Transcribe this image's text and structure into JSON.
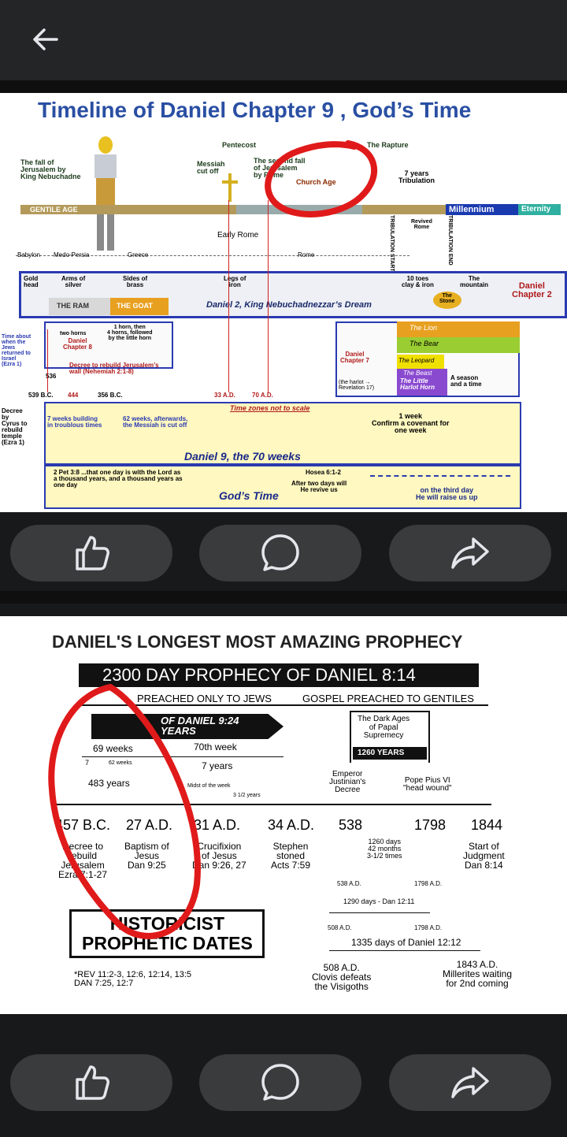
{
  "post1": {
    "title": "Timeline of Daniel Chapter 9 , God’s Time",
    "labels": {
      "fall_jerusalem": "The fall of\nJerusalem by\nKing Nebuchadne",
      "pentecost": "Pentecost",
      "rapture": "The Rapture",
      "messiah_cut": "Messiah\ncut off",
      "second_fall": "The second fall\nof Jerusalem\nby Rome",
      "church_age": "Church Age",
      "seven_years": "7 years\nTribulation",
      "gentile_age": "GENTILE AGE",
      "millennium": "Millennium",
      "eternity": "Eternity",
      "revived_rome": "Revived\nRome",
      "early_rome": "Early Rome",
      "trib_start": "TRIBULATION START",
      "trib_end": "TRIBULATION END",
      "babylon": "Babylon",
      "medo_persia": "Medo-Persia",
      "greece": "Greece",
      "rome": "Rome",
      "gold_head": "Gold\nhead",
      "arms_silver": "Arms of\nsilver",
      "sides_brass": "Sides of\nbrass",
      "legs_iron": "Legs of\niron",
      "toes": "10 toes\nclay & iron",
      "the_mountain": "The\nmountain",
      "daniel_ch2": "Daniel\nChapter 2",
      "the_ram": "THE RAM",
      "the_goat": "THE GOAT",
      "dream": "Daniel 2, King Nebuchadnezzar’s Dream",
      "the_stone": "The\nStone",
      "time_about": "Time about\nwhen the\nJews\nreturned to\nIsrael\n(Ezra 1)",
      "two_horns": "two horns",
      "daniel_ch8": "Daniel\nChapter 8",
      "one_horn": "1 horn, then\n4 horns, followed\nby the little horn",
      "the_lion": "The Lion",
      "the_bear": "The Bear",
      "the_leopard": "The Leopard",
      "the_beast": "The Beast",
      "the_little_horn": "The Little\nHarlot Horn",
      "daniel_ch7": "Daniel\nChapter 7",
      "season": "A season\nand a time",
      "harlot": "(the harlot →\nRevelation 17)",
      "decree_wall": "Decree to rebuild Jerusalem’s\nwall (Nehemiah 2:1-8)",
      "y536": "536",
      "y539": "539 B.C.",
      "y444": "444",
      "y356": "356 B.C.",
      "y33": "33 A.D.",
      "y70": "70 A.D.",
      "time_zones": "Time zones not to scale",
      "decree_cyrus": "Decree\nby\nCyrus to\nrebuild\ntemple\n(Ezra 1)",
      "seven_weeks": "7 weeks building\nin troublous times",
      "sixty_two": "62 weeks, afterwards,\nthe Messiah is cut off",
      "one_week": "1 week\nConfirm a covenant for\none week",
      "seventy_weeks": "Daniel 9, the 70 weeks",
      "pet": "2 Pet 3:8 ...that one day is with the Lord as\na thousand years, and a thousand years as\none day",
      "hosea": "Hosea 6:1-2",
      "after_two": "After two days will\nHe revive us",
      "gods_time": "God’s Time",
      "third_day": "on the third day\nHe will raise us up"
    }
  },
  "post2": {
    "title": "DANIEL'S LONGEST MOST AMAZING PROPHECY",
    "banner": "2300 DAY PROPHECY OF DANIEL 8:14",
    "preached_jews": "PREACHED ONLY TO JEWS",
    "gospel_gentiles": "GOSPEL PREACHED TO GENTILES",
    "of_daniel": "OF DANIEL 9:24\nYEARS",
    "dark_ages": "The Dark Ages\nof Papal\nSupremecy",
    "years_1260": "1260 YEARS",
    "weeks_69": "69 weeks",
    "week_70": "70th week",
    "seven_years": "7 years",
    "weeks_62": "62 weeks",
    "seven": "7",
    "years_483": "483 years",
    "midst": "Midst of the week",
    "half_years": "3 1/2 years",
    "emperor": "Emperor\nJustinian's\nDecree",
    "pope": "Pope Pius VI\n\"head wound\"",
    "dates": [
      "457 B.C.",
      "27 A.D.",
      "31 A.D.",
      "34 A.D.",
      "538",
      "1798",
      "1844"
    ],
    "decree_text": "Decree to\nrebuild\nJerusalem\nEzra 7:1-27",
    "baptism": "Baptism of\nJesus\nDan 9:25",
    "crucifixion": "Crucifixion\nof Jesus\nDan 9:26, 27",
    "stephen": "Stephen\nstoned\nActs 7:59",
    "days_1260": "1260 days\n42 months\n3-1/2 times",
    "judgment": "Start of\nJudgment\nDan 8:14",
    "ad538": "538 A.D.",
    "ad1798": "1798 A.D.",
    "days_1290": "1290 days - Dan 12:11",
    "ad508": "508 A.D.",
    "days_1335": "1335 days of Daniel 12:12",
    "historicist": "HISTORICIST\nPROPHETIC DATES",
    "clovis": "508 A.D.\nClovis defeats\nthe Visigoths",
    "millerites": "1843 A.D.\nMillerites waiting\nfor 2nd coming",
    "rev": "*REV 11:2-3, 12:6, 12:14, 13:5\nDAN 7:25, 12:7"
  },
  "colors": {
    "bar_dark": "#242526",
    "pill": "#3a3b3c",
    "title_blue": "#2a4fa3",
    "circle_red": "#e01a1a"
  }
}
